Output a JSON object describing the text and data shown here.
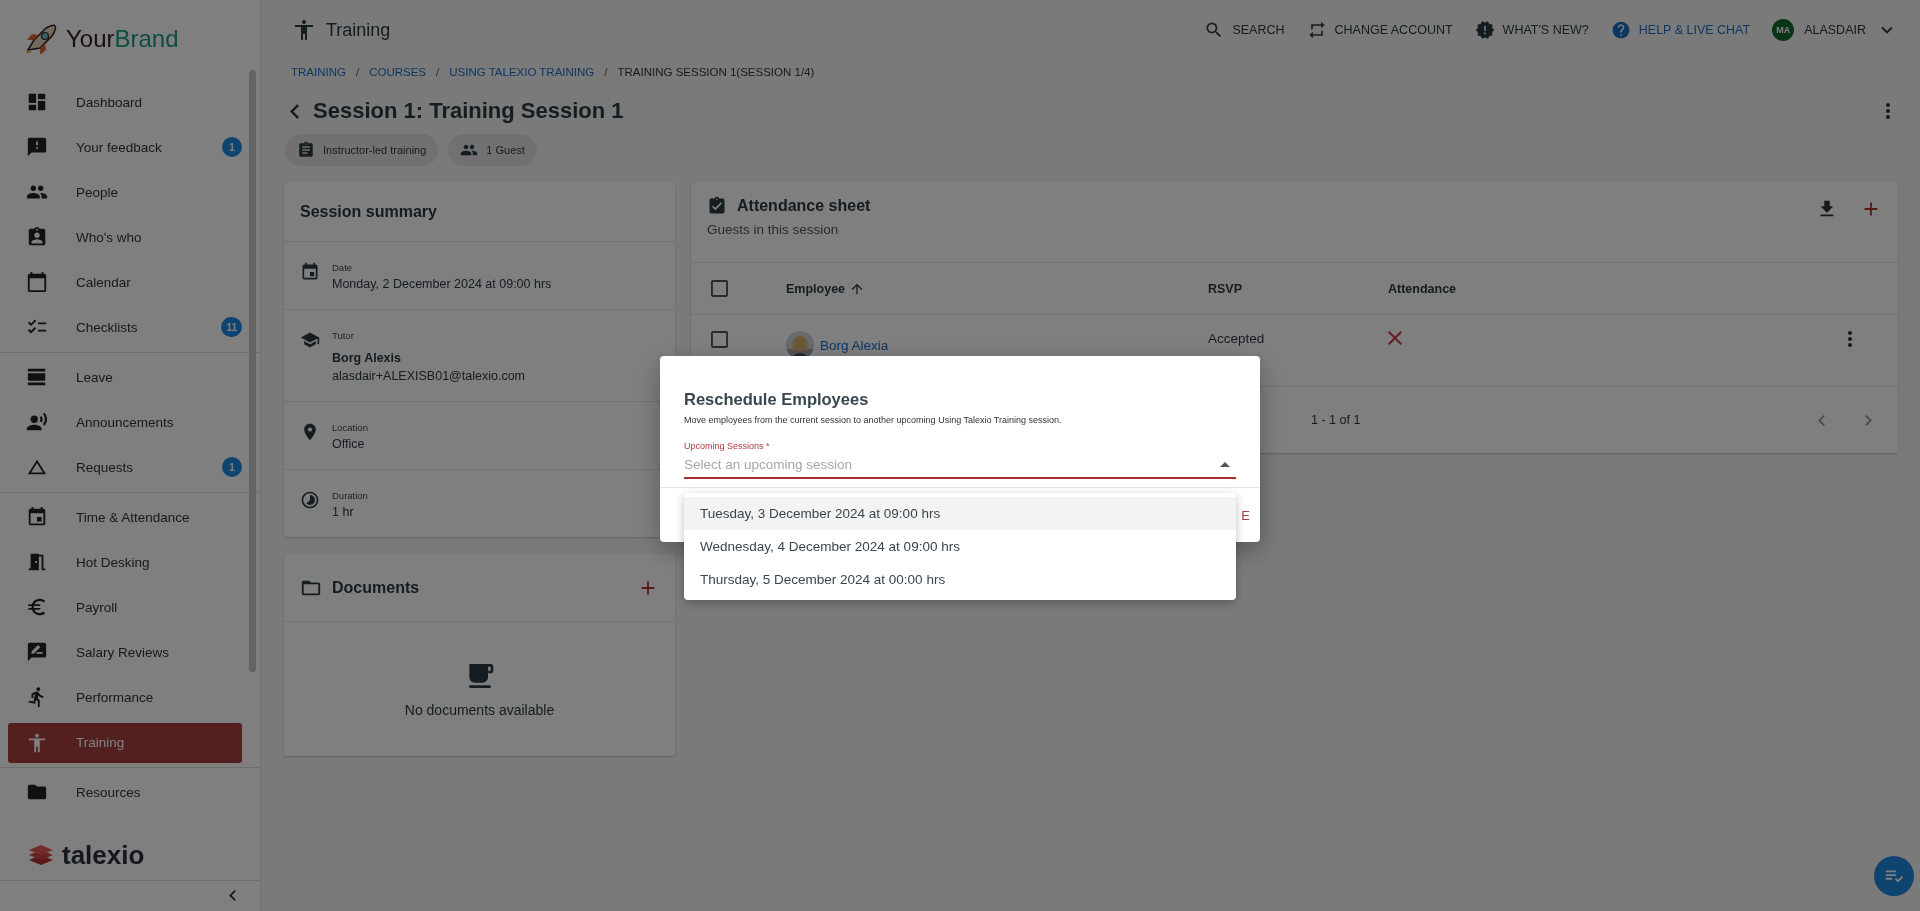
{
  "brand": {
    "first": "Your",
    "second": "Brand"
  },
  "sidebar": {
    "groups": [
      [
        {
          "label": "Dashboard",
          "selected": false
        },
        {
          "label": "Your feedback",
          "badge": "1",
          "selected": false
        },
        {
          "label": "People",
          "selected": false
        },
        {
          "label": "Who's who",
          "selected": false
        },
        {
          "label": "Calendar",
          "selected": false
        },
        {
          "label": "Checklists",
          "badge": "11",
          "selected": false
        }
      ],
      [
        {
          "label": "Leave",
          "selected": false
        },
        {
          "label": "Announcements",
          "selected": false
        },
        {
          "label": "Requests",
          "badge": "1",
          "selected": false
        }
      ],
      [
        {
          "label": "Time & Attendance",
          "selected": false
        },
        {
          "label": "Hot Desking",
          "selected": false
        },
        {
          "label": "Payroll",
          "selected": false
        },
        {
          "label": "Salary Reviews",
          "selected": false
        },
        {
          "label": "Performance",
          "selected": false
        },
        {
          "label": "Training",
          "selected": true
        }
      ],
      [
        {
          "label": "Resources",
          "selected": false
        }
      ]
    ],
    "footer_brand": "talexio"
  },
  "header": {
    "title": "Training",
    "actions": [
      {
        "label": "SEARCH",
        "kind": "plain"
      },
      {
        "label": "CHANGE ACCOUNT",
        "kind": "plain"
      },
      {
        "label": "WHAT'S NEW?",
        "kind": "plain"
      },
      {
        "label": "HELP & LIVE CHAT",
        "kind": "help"
      }
    ],
    "user": {
      "initials": "MA",
      "name": "ALASDAIR"
    }
  },
  "breadcrumbs": [
    {
      "label": "TRAINING",
      "current": false
    },
    {
      "label": "COURSES",
      "current": false
    },
    {
      "label": "USING TALEXIO TRAINING",
      "current": false
    },
    {
      "label": "TRAINING SESSION 1(SESSION 1/4)",
      "current": true
    }
  ],
  "breadcrumb_separator": "/",
  "page_title": "Session 1: Training Session 1",
  "chips": [
    "Instructor-led training",
    "1 Guest"
  ],
  "summary": {
    "title": "Session summary",
    "fields": [
      {
        "label": "Date",
        "value": "Monday, 2 December 2024 at 09:00 hrs"
      },
      {
        "label": "Tutor",
        "name": "Borg Alexis",
        "value": "alasdair+ALEXISB01@talexio.com"
      },
      {
        "label": "Location",
        "value": "Office"
      },
      {
        "label": "Duration",
        "value": "1 hr"
      }
    ]
  },
  "documents": {
    "title": "Documents",
    "empty_text": "No documents available"
  },
  "attendance": {
    "title": "Attendance sheet",
    "subtitle": "Guests in this session",
    "select_all": {
      "checked": false
    },
    "columns": [
      {
        "label": "Employee",
        "sorted": true
      },
      {
        "label": "RSVP",
        "sorted": false
      },
      {
        "label": "Attendance",
        "sorted": false
      }
    ],
    "rows": [
      {
        "name": "Borg Alexia",
        "rsvp": "Accepted",
        "checked": false,
        "present": false
      }
    ],
    "pagination": "1 - 1 of 1"
  },
  "dialog": {
    "title": "Reschedule Employees",
    "description": "Move employees from the current session to another upcoming Using Talexio Training session.",
    "field": {
      "label": "Upcoming Sessions *",
      "placeholder": "Select an upcoming session",
      "expanded": true
    },
    "options": [
      {
        "label": "Tuesday, 3 December 2024 at 09:00 hrs",
        "highlighted": true
      },
      {
        "label": "Wednesday, 4 December 2024 at 09:00 hrs",
        "highlighted": false
      },
      {
        "label": "Thursday, 5 December 2024 at 00:00 hrs",
        "highlighted": false
      }
    ],
    "action": "E"
  }
}
